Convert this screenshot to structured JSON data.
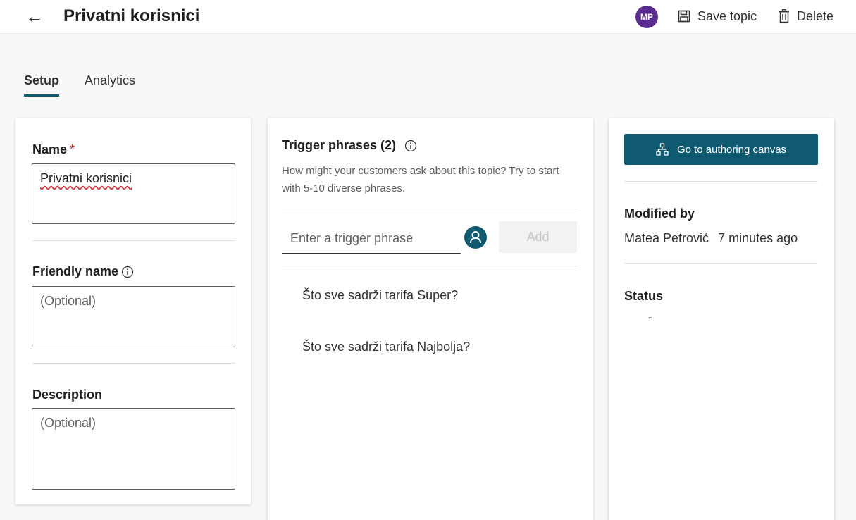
{
  "header": {
    "back_icon": "arrow-left-icon",
    "title": "Privatni korisnici",
    "avatar_initials": "MP",
    "avatar_color": "#5b2d91",
    "save_label": "Save topic",
    "delete_label": "Delete"
  },
  "tabs": [
    {
      "label": "Setup",
      "active": true
    },
    {
      "label": "Analytics",
      "active": false
    }
  ],
  "left_panel": {
    "name_label": "Name",
    "name_required": "*",
    "name_value": "Privatni korisnici",
    "friendly_label": "Friendly name",
    "friendly_placeholder": "(Optional)",
    "description_label": "Description",
    "description_placeholder": "(Optional)"
  },
  "trigger_panel": {
    "title": "Trigger phrases (2)",
    "description": "How might your customers ask about this topic? Try to start with 5-10 diverse phrases.",
    "input_placeholder": "Enter a trigger phrase",
    "add_label": "Add",
    "phrases": [
      "Što sve sadrži tarifa Super?",
      "Što sve sadrži tarifa Najbolja?"
    ]
  },
  "right_panel": {
    "canvas_button_label": "Go to authoring canvas",
    "modified_by_label": "Modified by",
    "modified_by_user": "Matea Petrović",
    "modified_time": "7 minutes ago",
    "status_label": "Status",
    "status_value": "-"
  },
  "colors": {
    "accent": "#0f5a71",
    "required": "#a4262c"
  }
}
